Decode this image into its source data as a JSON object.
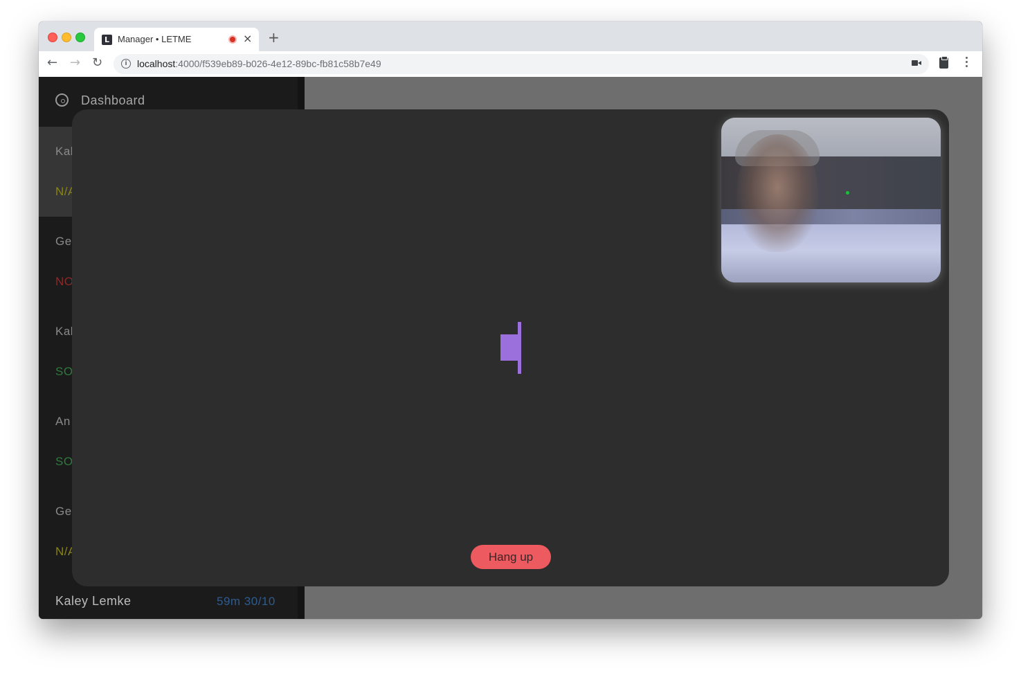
{
  "browser": {
    "tab": {
      "favicon_letter": "L",
      "title": "Manager • LETME",
      "recording_icon": "recording-dot-icon",
      "close_glyph": "×"
    },
    "new_tab_glyph": "+",
    "nav": {
      "back": "←",
      "forward": "→",
      "reload": "↻"
    },
    "address": {
      "info_glyph": "i",
      "host": "localhost",
      "path": ":4000/f539eb89-b026-4e12-89bc-fb81c58b7e49"
    },
    "toolbar_icons": [
      "camera-icon",
      "clipboard-icon",
      "menu-icon"
    ]
  },
  "sidebar": {
    "dashboard_label": "Dashboard",
    "items": [
      {
        "name": "Kal",
        "status": "N/A",
        "status_color": "#8a8418"
      },
      {
        "name": "Ge",
        "status": "NO",
        "status_color": "#8b2a2a"
      },
      {
        "name": "Kal",
        "status": "SO",
        "status_color": "#2f7a3e"
      },
      {
        "name": "An",
        "status": "SO",
        "status_color": "#2f7a3e"
      },
      {
        "name": "Ge",
        "status": "N/A",
        "status_color": "#8a8418"
      }
    ],
    "last_item": {
      "name": "Kaley Lemke",
      "meta": "59m 30/10"
    }
  },
  "call": {
    "hangup_label": "Hang up",
    "hangup_color": "#ed5a5f",
    "meter_color": "#9b6fdc"
  }
}
